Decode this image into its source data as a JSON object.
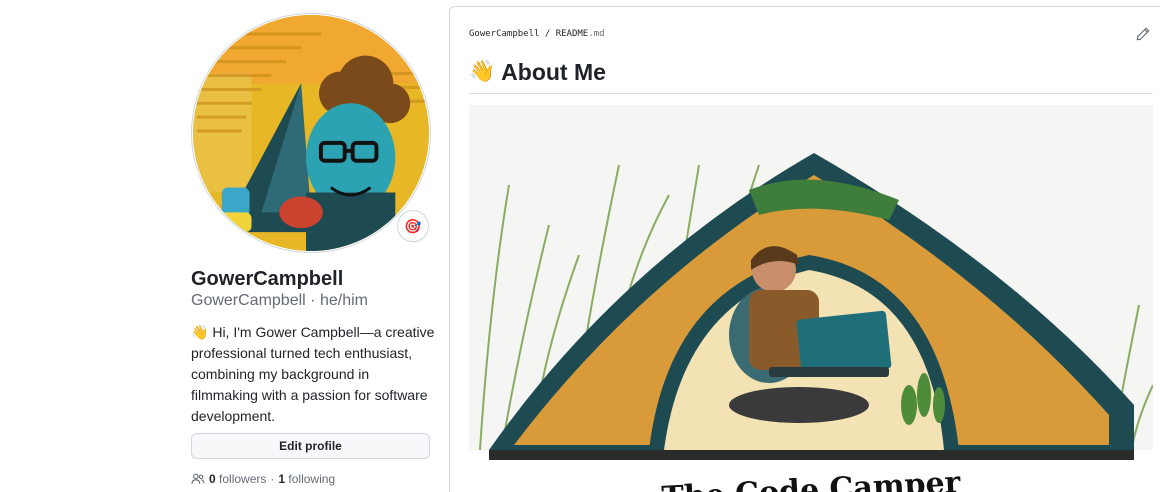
{
  "profile": {
    "name": "GowerCampbell",
    "username": "GowerCampbell",
    "pronouns": "he/him",
    "bio_emoji": "👋",
    "bio": "Hi, I'm Gower Campbell—a creative professional turned tech enthusiast, combining my background in filmmaking with a passion for software development.",
    "edit_profile_label": "Edit profile",
    "followers_count": "0",
    "followers_label": "followers",
    "following_count": "1",
    "following_label": "following",
    "separator": "·",
    "status_emoji": "🎯"
  },
  "readme": {
    "path_user": "GowerCampbell",
    "path_sep": "/",
    "path_file": "README",
    "path_ext": ".md",
    "heading_emoji": "👋",
    "heading": "About Me",
    "banner_caption": "The Code Camper"
  },
  "colors": {
    "border": "#d0d7de",
    "muted": "#636c76",
    "text": "#1f2328",
    "tent_orange": "#d99a3a",
    "tent_dark": "#1e4a52",
    "avatar_yellow": "#e8b726"
  }
}
